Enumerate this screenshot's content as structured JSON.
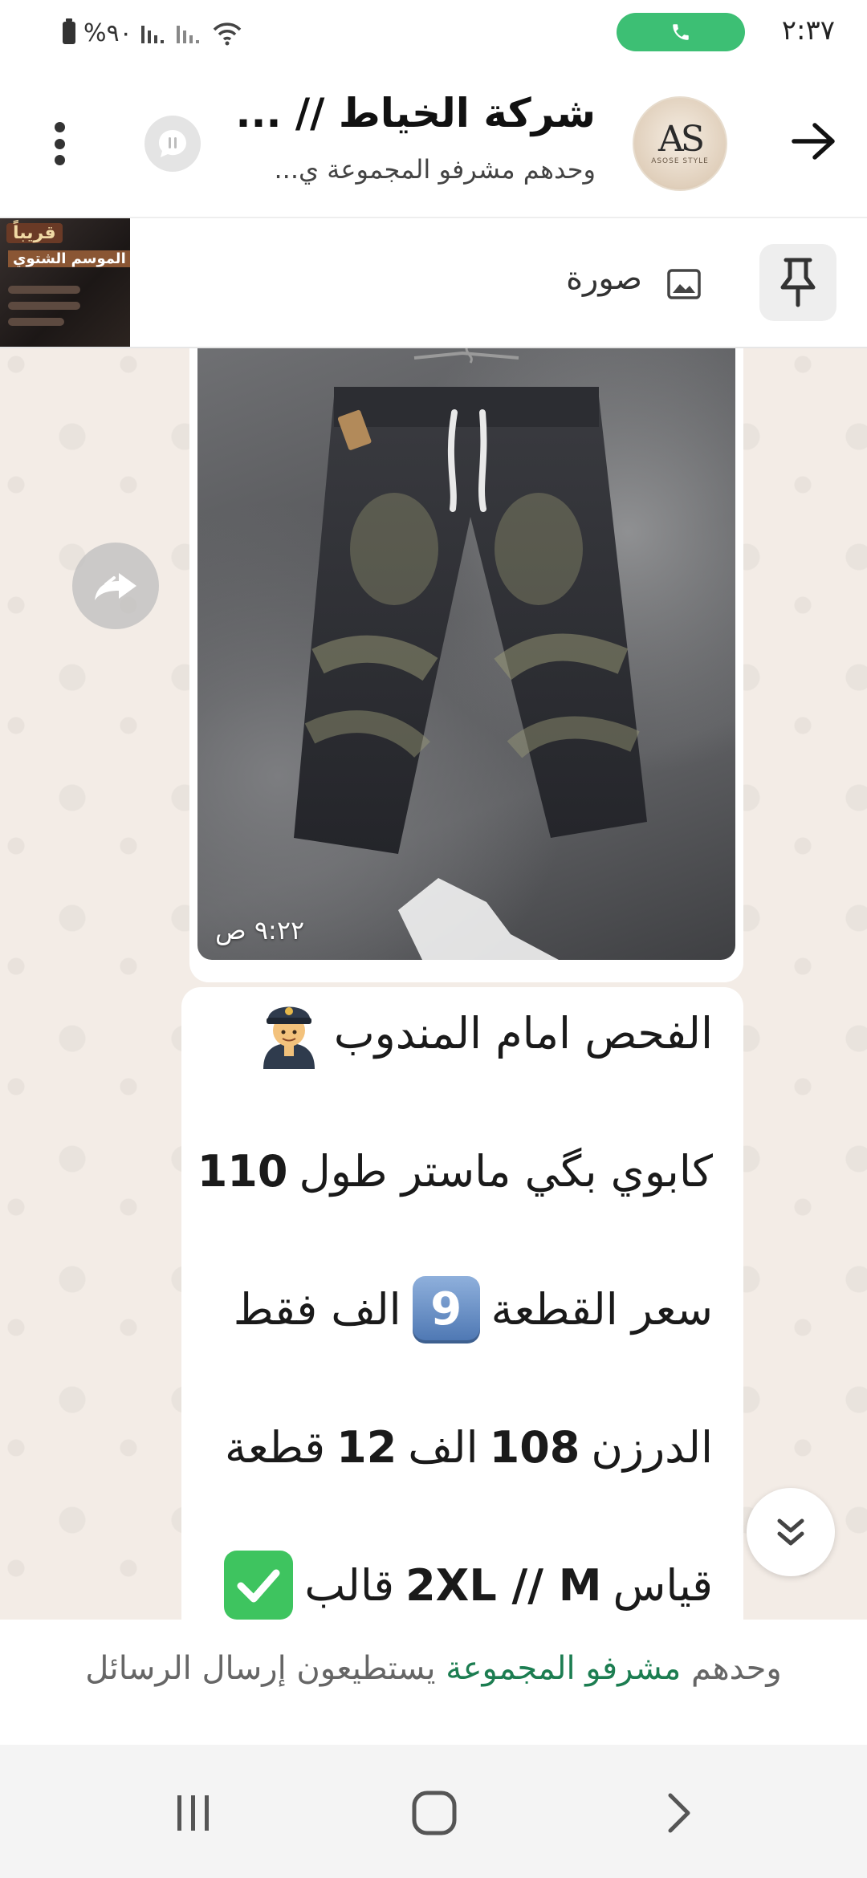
{
  "status_bar": {
    "time": "٢:٣٧",
    "battery": "%٩٠",
    "call_color": "#3dbf74"
  },
  "header": {
    "title": "شركة الخياط // ...",
    "subtitle": "وحدهم مشرفو المجموعة ي...",
    "avatar_logo": "AS",
    "avatar_subtext": "ASOSE STYLE",
    "icons": [
      "arrow-right-icon",
      "voice-chat-icon",
      "more-vert-icon"
    ]
  },
  "pinned": {
    "label": "صورة",
    "thumb_title": "قريباً",
    "thumb_subtitle": "الموسم الشتوي",
    "icons": [
      "pin-icon",
      "image-icon"
    ]
  },
  "messages": {
    "image": {
      "time": "٩:٢٢ ص",
      "subject": "jeans-photo"
    },
    "text": {
      "line1": "الفحص امام المندوب",
      "line2_text": "كابوي بگي ماستر طول",
      "line2_num": "110",
      "line3_pre": "سعر القطعة",
      "line3_key": "9",
      "line3_post": "الف فقط",
      "line4_pre": "الدرزن",
      "line4_num1": "108",
      "line4_mid": "الف",
      "line4_num2": "12",
      "line4_post": "قطعة",
      "line5_pre": "قياس",
      "line5_sizes": "2XL // M",
      "line5_post": "قالب"
    }
  },
  "footer": {
    "note_pre": "وحدهم",
    "note_link": "مشرفو المجموعة",
    "note_post": "يستطيعون إرسال الرسائل",
    "link_color": "#1c7d51"
  },
  "nav": {
    "buttons": [
      "recents-icon",
      "home-icon",
      "back-icon"
    ]
  }
}
